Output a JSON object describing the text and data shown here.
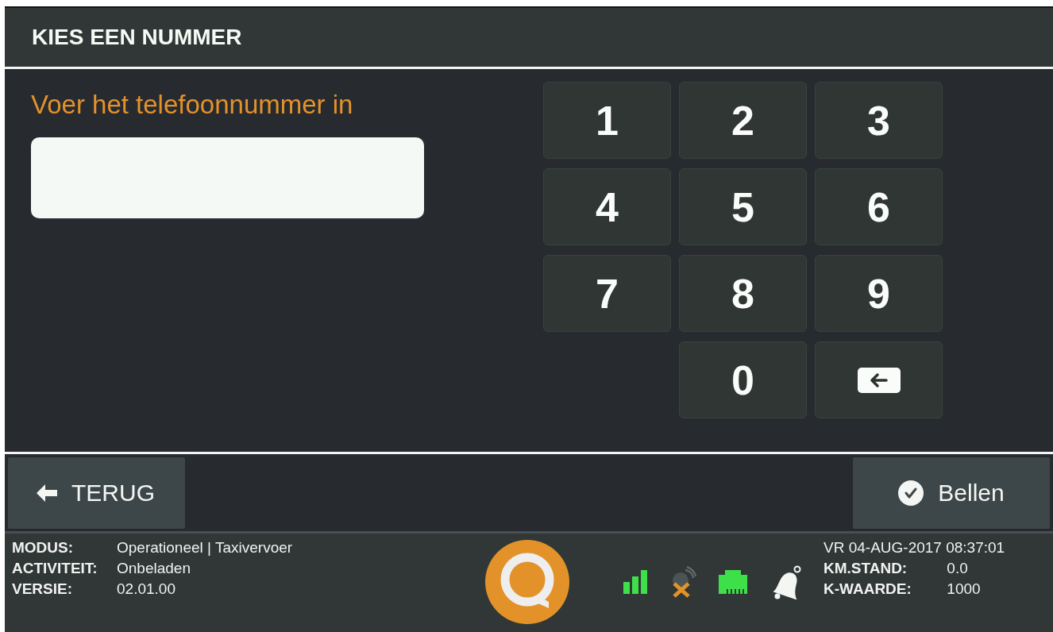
{
  "header": {
    "title": "KIES EEN NUMMER"
  },
  "entry": {
    "prompt": "Voer het telefoonnummer in"
  },
  "keypad": {
    "keys": [
      {
        "kind": "digit",
        "label": "1"
      },
      {
        "kind": "digit",
        "label": "2"
      },
      {
        "kind": "digit",
        "label": "3"
      },
      {
        "kind": "digit",
        "label": "4"
      },
      {
        "kind": "digit",
        "label": "5"
      },
      {
        "kind": "digit",
        "label": "6"
      },
      {
        "kind": "digit",
        "label": "7"
      },
      {
        "kind": "digit",
        "label": "8"
      },
      {
        "kind": "digit",
        "label": "9"
      },
      {
        "kind": "empty"
      },
      {
        "kind": "digit",
        "label": "0"
      },
      {
        "kind": "backspace"
      }
    ]
  },
  "actions": {
    "back": {
      "label": "TERUG"
    },
    "call": {
      "label": "Bellen"
    }
  },
  "status_bar": {
    "left": [
      {
        "label": "MODUS:",
        "value": "Operationeel | Taxivervoer"
      },
      {
        "label": "ACTIVITEIT:",
        "value": "Onbeladen"
      },
      {
        "label": "VERSIE:",
        "value": "02.01.00"
      }
    ],
    "datetime": "VR 04-AUG-2017 08:37:01",
    "right": [
      {
        "label": "KM.STAND:",
        "value": "0.0"
      },
      {
        "label": "K-WAARDE:",
        "value": "1000"
      }
    ]
  }
}
